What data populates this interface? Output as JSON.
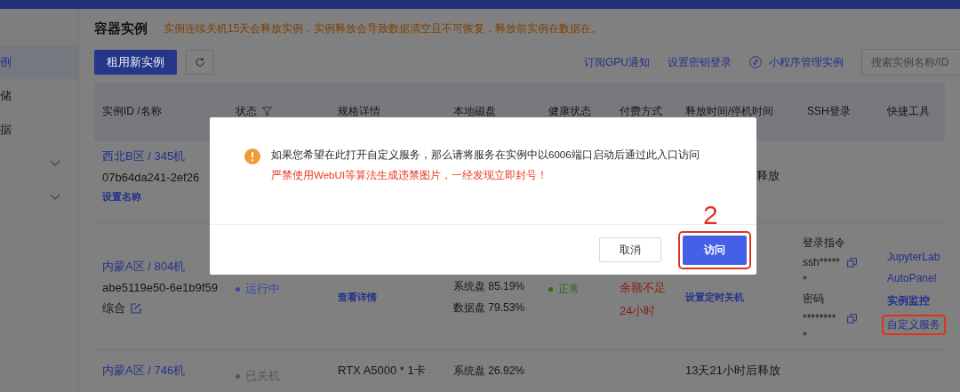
{
  "sidebar": {
    "items": [
      {
        "label": "例",
        "selected": true
      },
      {
        "label": "储",
        "selected": false
      },
      {
        "label": "据",
        "selected": false
      }
    ],
    "chevrons": [
      {
        "expanded": false
      },
      {
        "expanded": false
      }
    ]
  },
  "page": {
    "title": "容器实例",
    "notice": "实例连续关机15天会释放实例，实例释放会导致数据清空且不可恢复，释放前实例在数据在。"
  },
  "toolbar": {
    "primary_button": "租用新实例",
    "links": [
      {
        "label": "订阅GPU通知",
        "icon": false
      },
      {
        "label": "设置密钥登录",
        "icon": false
      },
      {
        "label": "小程序管理实例",
        "icon": true
      }
    ],
    "search": {
      "placeholder": "搜索实例名称/ID"
    }
  },
  "table": {
    "columns": [
      "实例ID /名称",
      "状态",
      "规格详情",
      "本地磁盘",
      "健康状态",
      "付费方式",
      "释放时间/停机时间",
      "SSH登录",
      "快捷工具"
    ],
    "rows": [
      {
        "region": "西北B区 / 345机",
        "id": "07b64da241-2ef26",
        "action": "设置名称",
        "release": "释放"
      },
      {
        "region": "内蒙A区 / 804机",
        "id": "abe5119e50-6e1b9f59",
        "name": "综合",
        "status": {
          "label": "运行中",
          "color": "#3447a8"
        },
        "spec_link": "查看详情",
        "disks": [
          "系统盘 85.19%",
          "数据盘 79.53%"
        ],
        "health": "正常",
        "billing": [
          "余额不足",
          "24小时"
        ],
        "release_link": "设置定时关机",
        "ssh": [
          {
            "label": "登录指令",
            "value": [
              "ssh*****",
              "*"
            ]
          },
          {
            "label": "密码",
            "value": [
              "********",
              "*"
            ]
          }
        ],
        "tools": [
          {
            "label": "JupyterLab",
            "bold": false,
            "highlighted": false
          },
          {
            "label": "AutoPanel",
            "bold": false,
            "highlighted": false
          },
          {
            "label": "实例监控",
            "bold": true,
            "highlighted": false
          },
          {
            "label": "自定义服务",
            "bold": false,
            "highlighted": true
          }
        ]
      },
      {
        "region": "内蒙A区 / 746机",
        "status": {
          "label": "已关机",
          "color": "#555555"
        },
        "spec": "RTX A5000 * 1卡",
        "disks": [
          "系统盘 26.92%"
        ],
        "release": "13天21小时后释放"
      }
    ]
  },
  "dialog": {
    "message": "如果您希望在此打开自定义服务，那么请将服务在实例中以6006端口启动后通过此入口访问",
    "warning": "严禁使用WebUI等算法生成违禁图片，一经发现立即封号！",
    "annotation_label": "2",
    "buttons": [
      {
        "label": "取消",
        "kind": "default",
        "highlighted": false
      },
      {
        "label": "访问",
        "kind": "primary",
        "highlighted": true
      }
    ]
  }
}
